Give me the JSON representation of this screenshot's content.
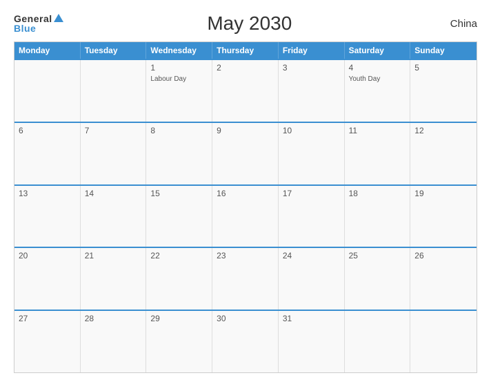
{
  "header": {
    "logo_general": "General",
    "logo_blue": "Blue",
    "title": "May 2030",
    "country": "China"
  },
  "calendar": {
    "weekdays": [
      "Monday",
      "Tuesday",
      "Wednesday",
      "Thursday",
      "Friday",
      "Saturday",
      "Sunday"
    ],
    "weeks": [
      [
        {
          "day": "",
          "holiday": ""
        },
        {
          "day": "",
          "holiday": ""
        },
        {
          "day": "1",
          "holiday": "Labour Day"
        },
        {
          "day": "2",
          "holiday": ""
        },
        {
          "day": "3",
          "holiday": ""
        },
        {
          "day": "4",
          "holiday": "Youth Day"
        },
        {
          "day": "5",
          "holiday": ""
        }
      ],
      [
        {
          "day": "6",
          "holiday": ""
        },
        {
          "day": "7",
          "holiday": ""
        },
        {
          "day": "8",
          "holiday": ""
        },
        {
          "day": "9",
          "holiday": ""
        },
        {
          "day": "10",
          "holiday": ""
        },
        {
          "day": "11",
          "holiday": ""
        },
        {
          "day": "12",
          "holiday": ""
        }
      ],
      [
        {
          "day": "13",
          "holiday": ""
        },
        {
          "day": "14",
          "holiday": ""
        },
        {
          "day": "15",
          "holiday": ""
        },
        {
          "day": "16",
          "holiday": ""
        },
        {
          "day": "17",
          "holiday": ""
        },
        {
          "day": "18",
          "holiday": ""
        },
        {
          "day": "19",
          "holiday": ""
        }
      ],
      [
        {
          "day": "20",
          "holiday": ""
        },
        {
          "day": "21",
          "holiday": ""
        },
        {
          "day": "22",
          "holiday": ""
        },
        {
          "day": "23",
          "holiday": ""
        },
        {
          "day": "24",
          "holiday": ""
        },
        {
          "day": "25",
          "holiday": ""
        },
        {
          "day": "26",
          "holiday": ""
        }
      ],
      [
        {
          "day": "27",
          "holiday": ""
        },
        {
          "day": "28",
          "holiday": ""
        },
        {
          "day": "29",
          "holiday": ""
        },
        {
          "day": "30",
          "holiday": ""
        },
        {
          "day": "31",
          "holiday": ""
        },
        {
          "day": "",
          "holiday": ""
        },
        {
          "day": "",
          "holiday": ""
        }
      ]
    ]
  }
}
